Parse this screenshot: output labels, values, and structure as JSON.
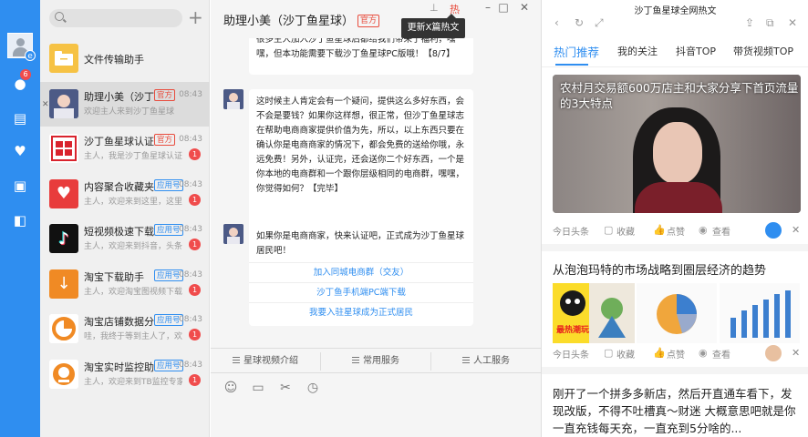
{
  "rail": {
    "chat_badge": "6",
    "avatar_badge": "e"
  },
  "list": {
    "chats": [
      {
        "name": "文件传输助手",
        "tag": "",
        "time": "",
        "preview": "",
        "unread": "",
        "icon": "folder-icon",
        "color": "#f6c244",
        "single": true
      },
      {
        "name": "助理小美（沙丁鱼星球）",
        "tag": "官方",
        "time": "08:43",
        "preview": "欢迎主人来到沙丁鱼星球",
        "unread": "",
        "icon": "girl-avatar",
        "color": "#3a4a7a",
        "selected": true
      },
      {
        "name": "沙丁鱼星球认证",
        "tag": "官方",
        "time": "08:43",
        "preview": "主人，我是沙丁鱼星球认证",
        "unread": "1",
        "icon": "certify-stamp-icon",
        "color": "#ffffff"
      },
      {
        "name": "内容聚合收藏夹",
        "tag": "应用号",
        "time": "08:43",
        "preview": "主人，欢迎来到这里，这里是",
        "unread": "1",
        "icon": "heart-icon",
        "color": "#e83c3c"
      },
      {
        "name": "短视频极速下载",
        "tag": "应用号",
        "time": "08:43",
        "preview": "主人，欢迎来到抖音，头条",
        "unread": "1",
        "icon": "tiktok-icon",
        "color": "#111111"
      },
      {
        "name": "淘宝下载助手",
        "tag": "应用号",
        "time": "08:43",
        "preview": "主人，欢迎淘宝图视频下载",
        "unread": "1",
        "icon": "download-arrow-icon",
        "color": "#f08a24"
      },
      {
        "name": "淘宝店铺数据分析",
        "tag": "应用号",
        "time": "08:43",
        "preview": "哇，我终于等到主人了，欢迎",
        "unread": "1",
        "icon": "pie-chart-icon",
        "color": "#ffffff"
      },
      {
        "name": "淘宝实时监控助手",
        "tag": "应用号",
        "time": "08:43",
        "preview": "主人，欢迎来到TB监控专家",
        "unread": "1",
        "icon": "monitor-icon",
        "color": "#ffffff"
      }
    ],
    "official_color": "#e84c3d",
    "app_color": "#2f8ef0"
  },
  "chat": {
    "title": "助理小美（沙丁鱼星球）",
    "official_tag": "官方",
    "tooltip": "更新X篇热文",
    "hot_label": "热",
    "messages": [
      {
        "text": "很多主人加入沙丁鱼星球后都给我们带来了福利，嘿嘿，但本功能需要下载沙丁鱼星球PC版哦！【8/7】"
      },
      {
        "text": "这时候主人肯定会有一个疑问，提供这么多好东西，会不会是要钱？如果你这样想，很正常，但沙丁鱼星球志在帮助电商商家提供价值为先，所以，以上东西只要在确认你是电商商家的情况下，都会免费的送给你哦，永远免费！另外，认证完，还会送你二个好东西，一个是你本地的电商群和一个跟你层级相同的电商群，嘿嘿，你觉得如何？【完毕】"
      },
      {
        "text": "如果你是电商商家，快来认证吧，正式成为沙丁鱼星球居民吧！"
      }
    ],
    "links": [
      "加入同城电商群（交友）",
      "沙丁鱼手机端PC端下载",
      "我要入驻星球成为正式居民"
    ],
    "toolbar": [
      "星球视频介绍",
      "常用服务",
      "人工服务"
    ]
  },
  "news": {
    "title": "沙丁鱼星球全网热文",
    "tabs": [
      "热门推荐",
      "我的关注",
      "抖音TOP",
      "带货视频TOP"
    ],
    "card1": {
      "headline": "农村月交易额600万店主和大家分享下首页流量的3大特点",
      "source": "今日头条",
      "collect": "收藏",
      "like": "点赞",
      "view": "查看"
    },
    "article2": {
      "title": "从泡泡玛特的市场战略到圈层经济的趋势",
      "thumb_text": "最热潮玩 扭蛋人气",
      "source": "今日头条",
      "collect": "收藏",
      "like": "点赞",
      "view": "查看"
    },
    "article3": {
      "text": "刚开了一个拼多多新店，然后开直通车看下，发现改版，不得不吐槽真～财迷 大概意思吧就是你一直充钱每天充，一直充到5分啥的..."
    }
  }
}
